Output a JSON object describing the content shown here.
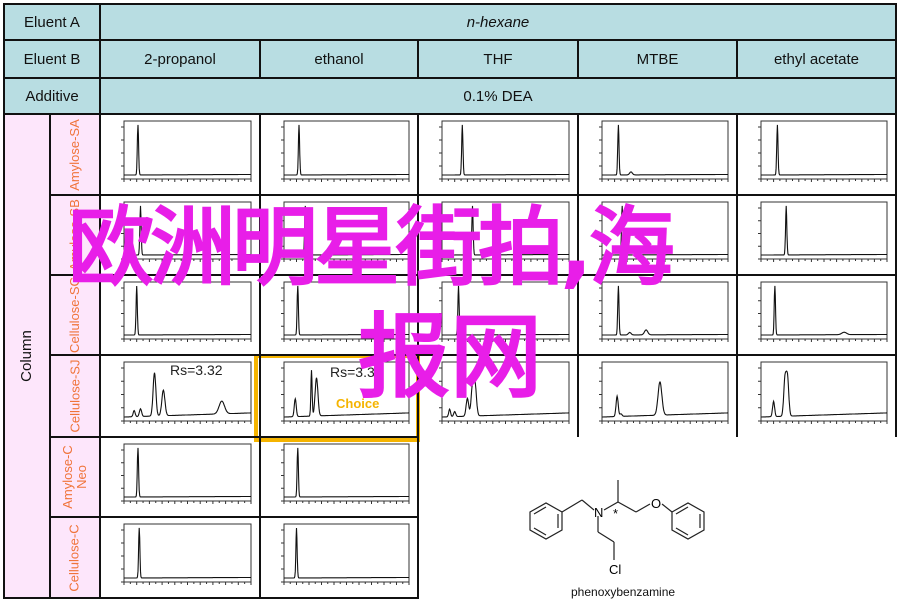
{
  "header": {
    "eluent_a_label": "Eluent A",
    "eluent_a_value": "n-hexane",
    "eluent_b_label": "Eluent B",
    "eluent_b_values": [
      "2-propanol",
      "ethanol",
      "THF",
      "MTBE",
      "ethyl acetate"
    ],
    "additive_label": "Additive",
    "additive_value": "0.1% DEA"
  },
  "column_label": "Column",
  "columns": [
    "Amylose-SA",
    "Amylose-SB",
    "Cellulose-SC",
    "Cellulose-SJ",
    "Amylose-C Neo",
    "Cellulose-C"
  ],
  "annotations": {
    "rs_sj_2propanol": "Rs=3.32",
    "rs_sj_ethanol": "Rs=3.32",
    "choice_label": "Choice"
  },
  "colors": {
    "header_bg": "#b8dde2",
    "column_bg": "#fde6fb",
    "column_text": "#f0743a",
    "highlight": "#f5b400",
    "watermark": "#e81ee8"
  },
  "chromatograms": {
    "x_range_min": [
      0,
      10
    ],
    "peaks": [
      [
        [
          [
            1.1,
            1.0
          ]
        ],
        [
          [
            1.2,
            1.0
          ]
        ],
        [
          [
            1.6,
            1.0
          ]
        ],
        [
          [
            1.3,
            1.0
          ],
          [
            2.3,
            0.06
          ]
        ],
        [
          [
            1.3,
            1.0
          ]
        ]
      ],
      [
        [
          [
            1.3,
            1.0
          ]
        ],
        [
          [
            1.7,
            1.0
          ]
        ],
        [
          [
            2.4,
            1.0
          ]
        ],
        [
          [
            1.6,
            1.0
          ]
        ],
        [
          [
            2.0,
            1.0
          ]
        ]
      ],
      [
        [
          [
            1.0,
            1.0
          ]
        ],
        [
          [
            1.1,
            1.0
          ]
        ],
        [
          [
            1.3,
            1.0
          ]
        ],
        [
          [
            1.3,
            1.0
          ],
          [
            2.2,
            0.05
          ],
          [
            3.5,
            0.1
          ]
        ],
        [
          [
            1.1,
            1.0
          ],
          [
            6.6,
            0.05
          ]
        ]
      ],
      [
        [
          [
            0.8,
            0.12
          ],
          [
            1.3,
            0.15
          ],
          [
            2.4,
            0.85
          ],
          [
            3.1,
            0.5
          ],
          [
            7.7,
            0.25
          ]
        ],
        [
          [
            0.9,
            0.35
          ],
          [
            2.2,
            0.9
          ],
          [
            2.6,
            0.75
          ]
        ],
        [
          [
            0.6,
            0.15
          ],
          [
            1.0,
            0.1
          ],
          [
            2.0,
            0.35
          ],
          [
            2.4,
            0.55
          ],
          [
            2.6,
            0.6
          ]
        ],
        [
          [
            1.2,
            0.4
          ],
          [
            1.5,
            0.05
          ],
          [
            4.6,
            0.65
          ]
        ],
        [
          [
            1.0,
            0.3
          ],
          [
            1.9,
            0.7
          ],
          [
            2.1,
            0.75
          ]
        ]
      ],
      [
        [
          [
            1.1,
            1.0
          ]
        ],
        [
          [
            1.1,
            1.0
          ]
        ]
      ],
      [
        [
          [
            1.2,
            1.0
          ]
        ],
        [
          [
            1.0,
            1.0
          ]
        ]
      ]
    ]
  },
  "molecule": {
    "name": "phenoxybenzamine",
    "atoms": [
      "N",
      "O",
      "Cl",
      "*"
    ]
  },
  "watermark": {
    "line1": "欧洲明星街拍,海",
    "line2": "报网"
  }
}
